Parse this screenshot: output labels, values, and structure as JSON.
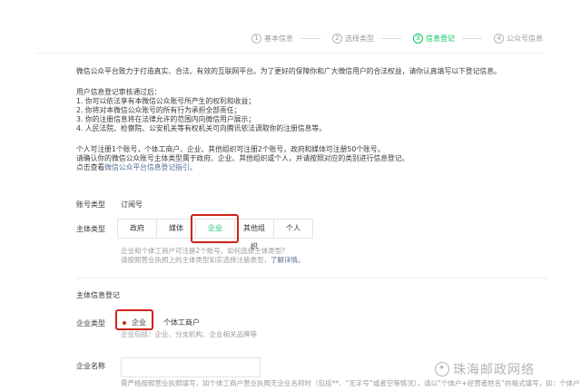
{
  "steps": [
    {
      "num": "1",
      "label": "基本信息"
    },
    {
      "num": "2",
      "label": "选择类型"
    },
    {
      "num": "3",
      "label": "信息登记"
    },
    {
      "num": "4",
      "label": "公众号信息"
    }
  ],
  "intro": "微信公众平台致力于打造真实、合法、有效的互联网平台。为了更好的保障你和广大微信用户的合法权益，请你认真填写以下登记信息。",
  "review": {
    "title": "用户信息登记审核通过后：",
    "items": [
      "1. 你可以依法享有本微信公众账号所产生的权利和收益；",
      "2. 你将对本微信公众账号的所有行为承担全部责任；",
      "3. 你的注册信息将在法律允许的范围内向微信用户展示；",
      "4. 人民法院、检察院、公安机关等有权机关可向腾讯依法调取你的注册信息等。"
    ]
  },
  "limits": {
    "line1": "个人可注册1个账号，个体工商户、企业、其他组织可注册2个账号，政府和媒体可注册50个账号。",
    "line2": "请确认你的微信公众账号主体类型属于政府、企业、其他组织或个人，并请按照对应的类别进行信息登记。",
    "line3_prefix": "点击查看",
    "line3_link": "微信公众平台信息登记指引。"
  },
  "account_type": {
    "label": "账号类型",
    "value": "订阅号"
  },
  "subject_type": {
    "label": "主体类型",
    "options": [
      "政府",
      "媒体",
      "企业",
      "其他组织",
      "个人"
    ],
    "selected": "企业",
    "hint1": "企业和个体工商户可注册2个账号。如何选择主体类型？",
    "hint2_prefix": "请按照营业执照上的主体类型如实选择注册类型，",
    "hint2_link": "了解详情。"
  },
  "section_title": "主体信息登记",
  "enterprise_type": {
    "label": "企业类型",
    "options": [
      "企业",
      "个体工商户"
    ],
    "selected": "企业",
    "hint": "企业包括：企业、分支机构、企业相关品牌等"
  },
  "enterprise_name": {
    "label": "企业名称",
    "value": "",
    "hint": "需严格按照营业执照填写，如个体工商户营业执照无企业名称时（包括**、“无字号”或者空等情况），请以“个体户+经营者姓名”的格式填写，如：个体户"
  },
  "watermark": "珠海邮政网络",
  "colors": {
    "accent": "#07c160",
    "highlight": "#d1221b",
    "link": "#576b95"
  }
}
